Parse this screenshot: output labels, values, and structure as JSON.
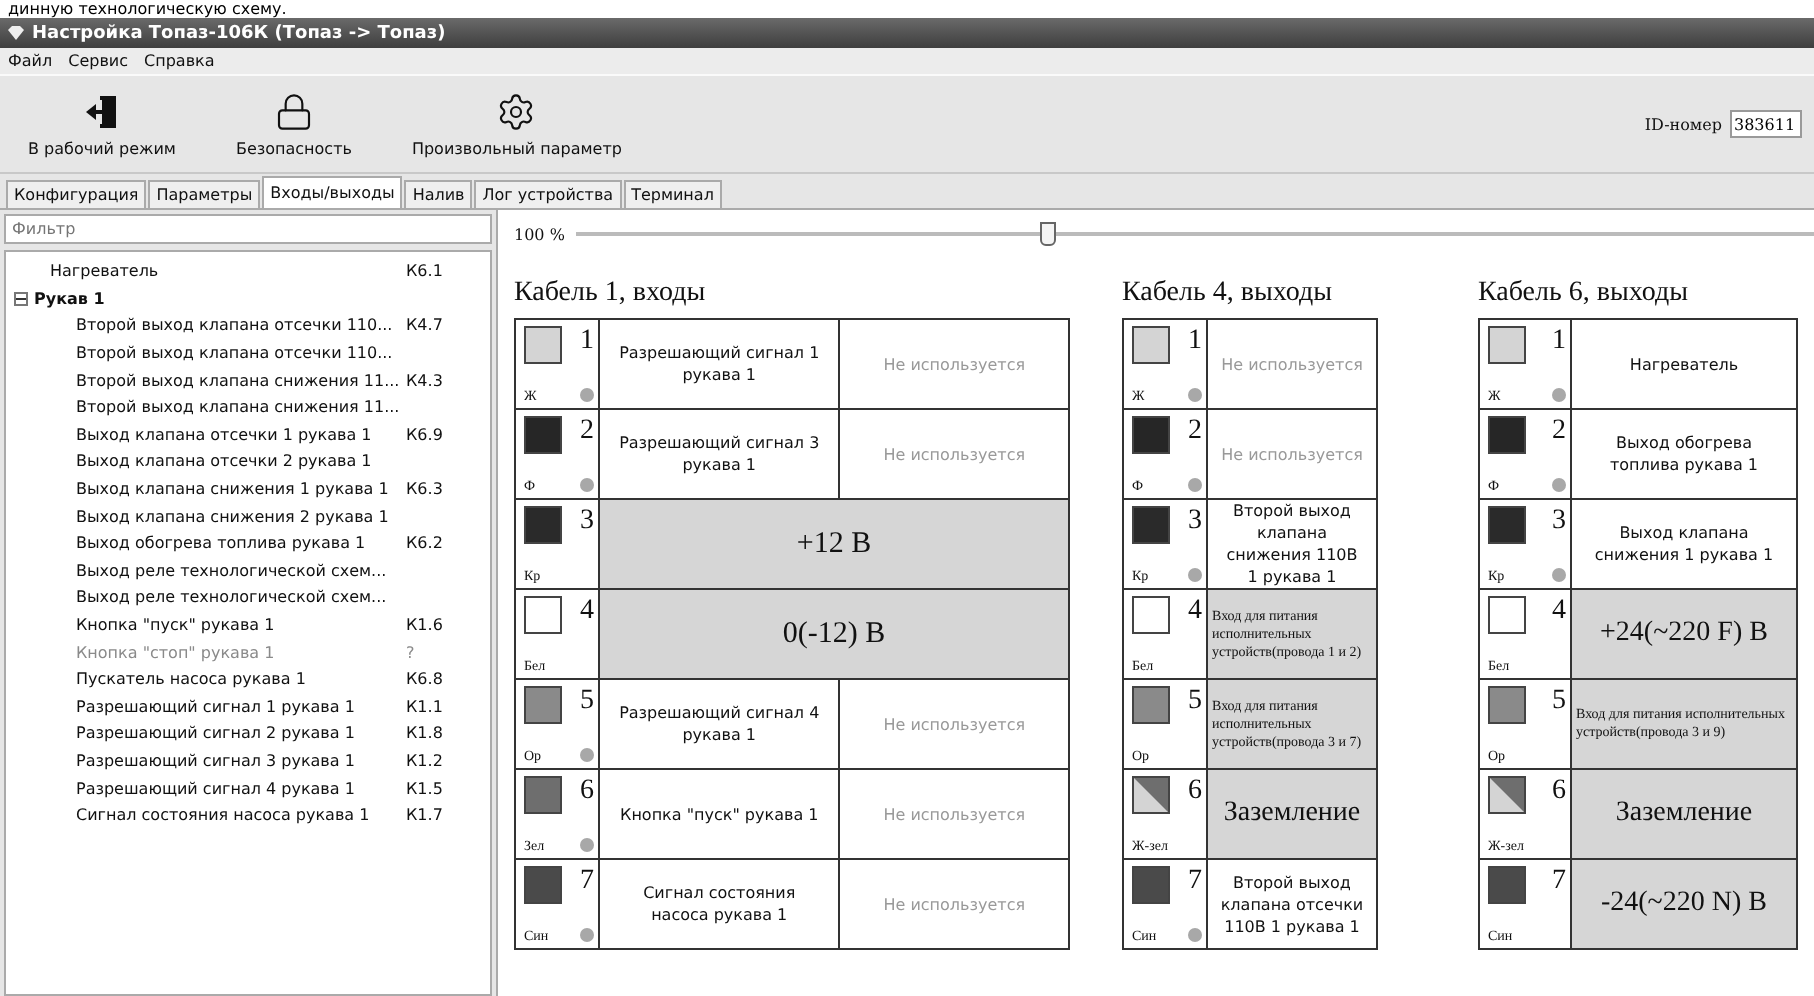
{
  "caption": "динную технологическую схему.",
  "window": {
    "title": "Настройка Топаз-106К (Топаз -> Топаз)"
  },
  "menu": [
    "Файл",
    "Сервис",
    "Справка"
  ],
  "toolbar": [
    {
      "kind": "exit",
      "label": "В рабочий режим"
    },
    {
      "kind": "lock",
      "label": "Безопасность"
    },
    {
      "kind": "param",
      "label": "Произвольный параметр"
    }
  ],
  "id_field": {
    "label": "ID-номер",
    "value": "383611"
  },
  "tabs": [
    {
      "label": "Конфигурация",
      "selected": false
    },
    {
      "label": "Параметры",
      "selected": false
    },
    {
      "label": "Входы/выходы",
      "selected": true
    },
    {
      "label": "Налив",
      "selected": false
    },
    {
      "label": "Лог устройства",
      "selected": false
    },
    {
      "label": "Терминал",
      "selected": false
    }
  ],
  "filter": {
    "placeholder": "Фильтр"
  },
  "tree": [
    {
      "name": "Нагреватель",
      "code": "К6.1",
      "disabled": false
    },
    {
      "name": "Рукав 1",
      "expanded": true,
      "children": [
        {
          "name": "Второй выход клапана отсечки 110...",
          "code": "К4.7",
          "disabled": false
        },
        {
          "name": "Второй выход клапана отсечки 110...",
          "disabled": false
        },
        {
          "name": "Второй выход клапана снижения 11...",
          "code": "К4.3",
          "disabled": false
        },
        {
          "name": "Второй выход клапана снижения 11...",
          "disabled": false
        },
        {
          "name": "Выход клапана отсечки 1 рукава 1",
          "code": "К6.9",
          "disabled": false
        },
        {
          "name": "Выход клапана отсечки 2 рукава 1",
          "disabled": false
        },
        {
          "name": "Выход клапана снижения 1 рукава 1",
          "code": "К6.3",
          "disabled": false
        },
        {
          "name": "Выход клапана снижения 2 рукава 1",
          "disabled": false
        },
        {
          "name": "Выход обогрева топлива рукава 1",
          "code": "К6.2",
          "disabled": false
        },
        {
          "name": "Выход реле технологической схем...",
          "disabled": false
        },
        {
          "name": "Выход реле технологической схем...",
          "disabled": false
        },
        {
          "name": "Кнопка \"пуск\" рукава 1",
          "code": "К1.6",
          "disabled": false
        },
        {
          "name": "Кнопка \"стоп\" рукава 1",
          "code": "?",
          "disabled": true
        },
        {
          "name": "Пускатель насоса рукава 1",
          "code": "К6.8",
          "disabled": false
        },
        {
          "name": "Разрешающий сигнал 1 рукава 1",
          "code": "К1.1",
          "disabled": false
        },
        {
          "name": "Разрешающий сигнал 2 рукава 1",
          "code": "К1.8",
          "disabled": false
        },
        {
          "name": "Разрешающий сигнал 3 рукава 1",
          "code": "К1.2",
          "disabled": false
        },
        {
          "name": "Разрешающий сигнал 4 рукава 1",
          "code": "К1.5",
          "disabled": false
        },
        {
          "name": "Сигнал состояния насоса рукава 1",
          "code": "К1.7",
          "disabled": false
        }
      ]
    }
  ],
  "zoom": {
    "label": "100 %",
    "level": 0.38
  },
  "cables": [
    {
      "title": "Кабель 1, входы",
      "rows": [
        {
          "number": "1",
          "wire": "Ж",
          "color": "#d4d4d4",
          "indicator": true,
          "kind": "pair",
          "name": "Разрешающий сигнал 1 рукава 1",
          "status": "Не используется"
        },
        {
          "number": "2",
          "wire": "Ф",
          "color": "#262626",
          "indicator": true,
          "kind": "pair",
          "name": "Разрешающий сигнал 3 рукава 1",
          "status": "Не используется"
        },
        {
          "number": "3",
          "wire": "Кр",
          "color": "#2a2a2a",
          "indicator": false,
          "kind": "power",
          "name": "+12 В"
        },
        {
          "number": "4",
          "wire": "Бел",
          "color": "#ffffff",
          "indicator": false,
          "kind": "power",
          "name": "0(-12) В"
        },
        {
          "number": "5",
          "wire": "Ор",
          "color": "#8a8a8a",
          "indicator": true,
          "kind": "pair",
          "name": "Разрешающий сигнал 4 рукава 1",
          "status": "Не используется"
        },
        {
          "number": "6",
          "wire": "Зел",
          "color": "#6e6e6e",
          "indicator": true,
          "kind": "pair",
          "name": "Кнопка \"пуск\" рукава 1",
          "status": "Не используется"
        },
        {
          "number": "7",
          "wire": "Син",
          "color": "#4a4a4a",
          "indicator": true,
          "kind": "pair",
          "name": "Сигнал состояния насоса рукава 1",
          "status": "Не используется"
        }
      ]
    },
    {
      "title": "Кабель 4, выходы",
      "rows": [
        {
          "number": "1",
          "wire": "Ж",
          "color": "#d4d4d4",
          "indicator": true,
          "kind": "unused",
          "name": "Не используется"
        },
        {
          "number": "2",
          "wire": "Ф",
          "color": "#262626",
          "indicator": true,
          "kind": "unused",
          "name": "Не используется"
        },
        {
          "number": "3",
          "wire": "Кр",
          "color": "#2a2a2a",
          "indicator": true,
          "kind": "signal",
          "name": "Второй выход клапана снижения 110В 1 рукава 1"
        },
        {
          "number": "4",
          "wire": "Бел",
          "color": "#ffffff",
          "indicator": false,
          "kind": "note",
          "name": "Вход для питания исполнительных устройств(провода 1 и 2)"
        },
        {
          "number": "5",
          "wire": "Ор",
          "color": "#8a8a8a",
          "indicator": false,
          "kind": "note",
          "name": "Вход для питания исполнительных устройств(провода 3 и 7)"
        },
        {
          "number": "6",
          "wire": "Ж-зел",
          "color": "#d4d4d4",
          "stripe": {
            "color": "#6e6e6e"
          },
          "indicator": false,
          "kind": "power",
          "name": "Заземление"
        },
        {
          "number": "7",
          "wire": "Син",
          "color": "#4a4a4a",
          "indicator": true,
          "kind": "signal",
          "name": "Второй выход клапана отсечки 110В 1 рукава 1"
        }
      ]
    },
    {
      "title": "Кабель 6, выходы",
      "rows": [
        {
          "number": "1",
          "wire": "Ж",
          "color": "#d4d4d4",
          "indicator": true,
          "kind": "signal",
          "name": "Нагреватель"
        },
        {
          "number": "2",
          "wire": "Ф",
          "color": "#262626",
          "indicator": true,
          "kind": "signal",
          "name": "Выход обогрева топлива рукава 1"
        },
        {
          "number": "3",
          "wire": "Кр",
          "color": "#2a2a2a",
          "indicator": true,
          "kind": "signal",
          "name": "Выход клапана снижения 1 рукава 1"
        },
        {
          "number": "4",
          "wire": "Бел",
          "color": "#ffffff",
          "indicator": false,
          "kind": "power",
          "name": "+24(~220 F) В"
        },
        {
          "number": "5",
          "wire": "Ор",
          "color": "#8a8a8a",
          "indicator": false,
          "kind": "note",
          "name": "Вход для питания исполнительных устройств(провода 3 и 9)"
        },
        {
          "number": "6",
          "wire": "Ж-зел",
          "color": "#d4d4d4",
          "stripe": {
            "color": "#6e6e6e"
          },
          "indicator": false,
          "kind": "power",
          "name": "Заземление"
        },
        {
          "number": "7",
          "wire": "Син",
          "color": "#4a4a4a",
          "indicator": false,
          "kind": "power",
          "name": "-24(~220 N) В"
        }
      ]
    }
  ]
}
